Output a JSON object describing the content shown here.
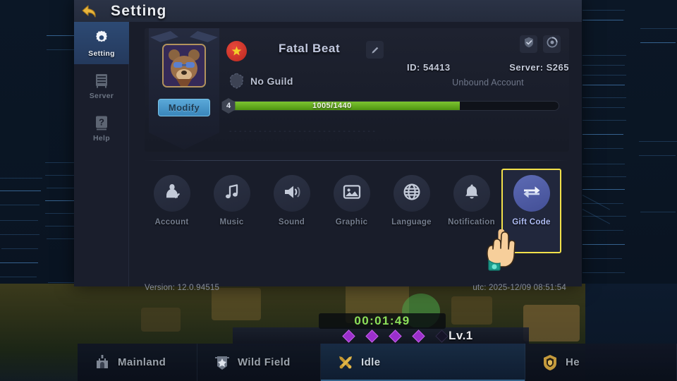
{
  "panel": {
    "title": "Setting",
    "back_icon": "back-arrow-icon"
  },
  "sidebar": {
    "items": [
      {
        "label": "Setting",
        "icon": "gear-icon",
        "active": true
      },
      {
        "label": "Server",
        "icon": "server-icon",
        "active": false
      },
      {
        "label": "Help",
        "icon": "question-mark-icon",
        "active": false
      }
    ]
  },
  "profile": {
    "avatar_icon": "bear-avatar",
    "modify_label": "Modify",
    "flag_icon": "red-star-flag-icon",
    "player_name": "Fatal Beat",
    "edit_icon": "pencil-icon",
    "guild_icon": "guild-shield-icon",
    "guild_name": "No Guild",
    "id_label": "ID: 54413",
    "server_label": "Server: S265",
    "bind_status": "Unbound Account",
    "account_buttons": [
      {
        "icon": "shield-check-icon"
      },
      {
        "icon": "badge-circle-icon"
      }
    ],
    "level": "4",
    "xp_text": "1005/1440",
    "xp_percent": 70,
    "signature": "- - - - - - - - - - - - - - - - - - - - - - - - - - - - - -"
  },
  "settings": {
    "items": [
      {
        "label": "Account",
        "icon": "account-person-icon",
        "highlighted": false
      },
      {
        "label": "Music",
        "icon": "music-note-icon",
        "highlighted": false
      },
      {
        "label": "Sound",
        "icon": "speaker-icon",
        "highlighted": false
      },
      {
        "label": "Graphic",
        "icon": "image-picture-icon",
        "highlighted": false
      },
      {
        "label": "Language",
        "icon": "globe-icon",
        "highlighted": false
      },
      {
        "label": "Notification",
        "icon": "bell-icon",
        "highlighted": false
      },
      {
        "label": "Gift Code",
        "icon": "exchange-arrows-icon",
        "highlighted": true
      }
    ],
    "highlight_color": "#f2e14a"
  },
  "footer": {
    "version": "Version: 12.0.94515",
    "utc_time": "utc: 2025-12/09 08:51:54"
  },
  "game_hud": {
    "timer": "00:01:49",
    "level": "Lv.1",
    "gems_filled": 4,
    "gems_total": 5
  },
  "bottom_nav": {
    "items": [
      {
        "label": "Mainland",
        "icon": "castle-icon",
        "active": false
      },
      {
        "label": "Wild Field",
        "icon": "banner-star-icon",
        "active": false
      },
      {
        "label": "Idle",
        "icon": "crossed-swords-icon",
        "active": true
      },
      {
        "label": "He",
        "icon": "hero-shield-icon",
        "active": false
      }
    ]
  },
  "cursor": {
    "icon": "pointing-hand-cursor"
  }
}
